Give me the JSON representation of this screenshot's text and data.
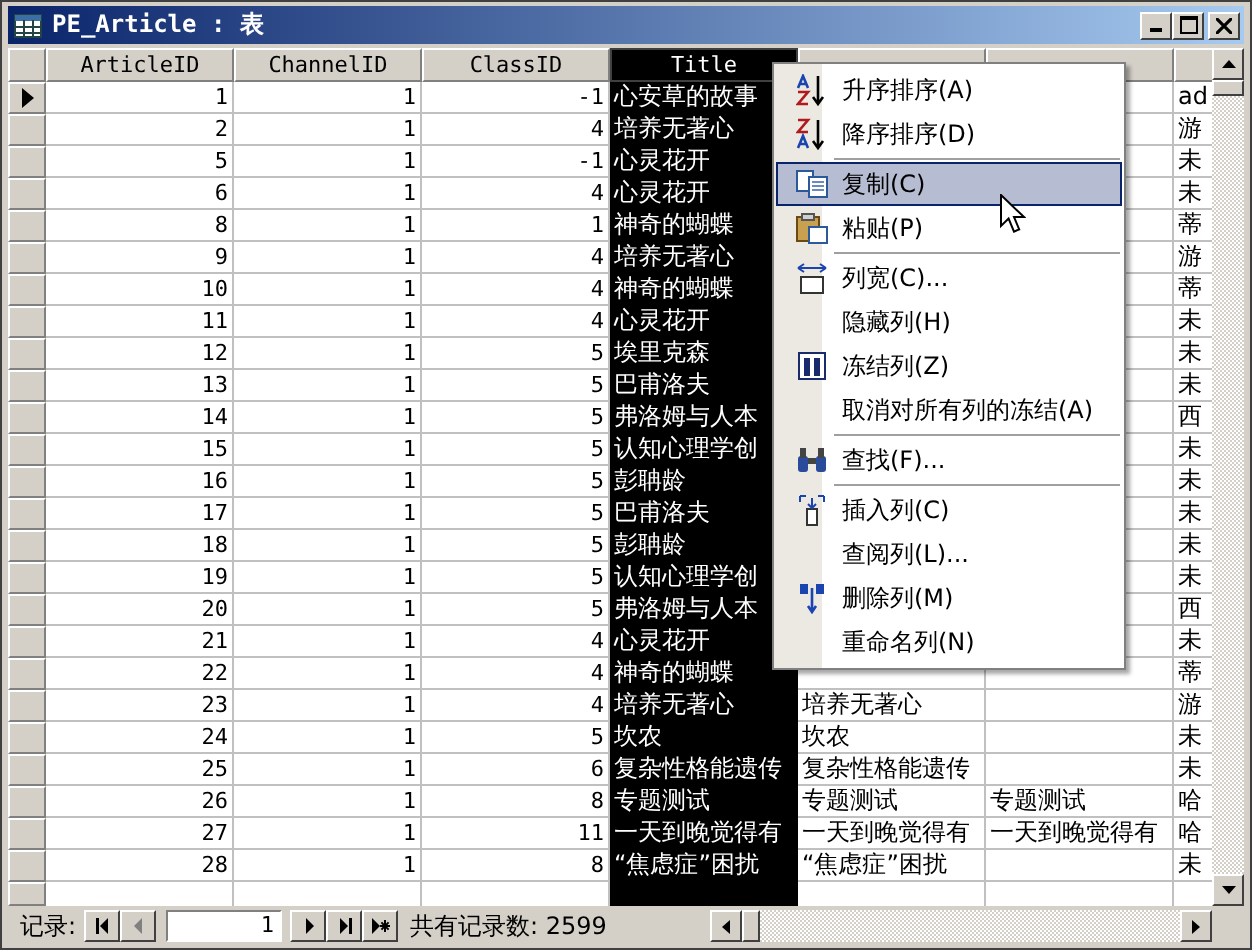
{
  "window": {
    "title": "PE_Article : 表"
  },
  "columns": [
    {
      "label": "ArticleID",
      "selected": false
    },
    {
      "label": "ChannelID",
      "selected": false
    },
    {
      "label": "ClassID",
      "selected": false
    },
    {
      "label": "Title",
      "selected": true
    },
    {
      "selected": false
    },
    {
      "selected": false
    },
    {
      "selected": false
    }
  ],
  "rows": [
    {
      "current": true,
      "cells": [
        "1",
        "1",
        "-1",
        "心安草的故事",
        "",
        "",
        "ad"
      ]
    },
    {
      "current": false,
      "cells": [
        "2",
        "1",
        "4",
        "培养无著心",
        "",
        "",
        "游"
      ]
    },
    {
      "current": false,
      "cells": [
        "5",
        "1",
        "-1",
        "心灵花开",
        "",
        "",
        "未"
      ]
    },
    {
      "current": false,
      "cells": [
        "6",
        "1",
        "4",
        "心灵花开",
        "",
        "",
        "未"
      ]
    },
    {
      "current": false,
      "cells": [
        "8",
        "1",
        "1",
        "神奇的蝴蝶",
        "",
        "",
        "蒂"
      ]
    },
    {
      "current": false,
      "cells": [
        "9",
        "1",
        "4",
        "培养无著心",
        "",
        "",
        "游"
      ]
    },
    {
      "current": false,
      "cells": [
        "10",
        "1",
        "4",
        "神奇的蝴蝶",
        "",
        "",
        "蒂"
      ]
    },
    {
      "current": false,
      "cells": [
        "11",
        "1",
        "4",
        "心灵花开",
        "",
        "",
        "未"
      ]
    },
    {
      "current": false,
      "cells": [
        "12",
        "1",
        "5",
        "埃里克森",
        "",
        "",
        "未"
      ]
    },
    {
      "current": false,
      "cells": [
        "13",
        "1",
        "5",
        "巴甫洛夫",
        "",
        "",
        "未"
      ]
    },
    {
      "current": false,
      "cells": [
        "14",
        "1",
        "5",
        "弗洛姆与人本",
        "",
        "",
        "西"
      ]
    },
    {
      "current": false,
      "cells": [
        "15",
        "1",
        "5",
        "认知心理学创",
        "",
        "",
        "未"
      ]
    },
    {
      "current": false,
      "cells": [
        "16",
        "1",
        "5",
        "彭聃龄",
        "",
        "",
        "未"
      ]
    },
    {
      "current": false,
      "cells": [
        "17",
        "1",
        "5",
        "巴甫洛夫",
        "",
        "",
        "未"
      ]
    },
    {
      "current": false,
      "cells": [
        "18",
        "1",
        "5",
        "彭聃龄",
        "",
        "",
        "未"
      ]
    },
    {
      "current": false,
      "cells": [
        "19",
        "1",
        "5",
        "认知心理学创",
        "",
        "",
        "未"
      ]
    },
    {
      "current": false,
      "cells": [
        "20",
        "1",
        "5",
        "弗洛姆与人本",
        "",
        "",
        "西"
      ]
    },
    {
      "current": false,
      "cells": [
        "21",
        "1",
        "4",
        "心灵花开",
        "",
        "",
        "未"
      ]
    },
    {
      "current": false,
      "cells": [
        "22",
        "1",
        "4",
        "神奇的蝴蝶",
        "",
        "",
        "蒂"
      ]
    },
    {
      "current": false,
      "cells": [
        "23",
        "1",
        "4",
        "培养无著心",
        "培养无著心",
        "",
        "游"
      ]
    },
    {
      "current": false,
      "cells": [
        "24",
        "1",
        "5",
        "坎农",
        "坎农",
        "",
        "未"
      ]
    },
    {
      "current": false,
      "cells": [
        "25",
        "1",
        "6",
        "复杂性格能遗传",
        "复杂性格能遗传",
        "",
        "未"
      ]
    },
    {
      "current": false,
      "cells": [
        "26",
        "1",
        "8",
        "专题测试",
        "专题测试",
        "专题测试",
        "哈"
      ]
    },
    {
      "current": false,
      "cells": [
        "27",
        "1",
        "11",
        "一天到晚觉得有",
        "一天到晚觉得有",
        "一天到晚觉得有",
        "哈"
      ]
    },
    {
      "current": false,
      "cells": [
        "28",
        "1",
        "8",
        "“焦虑症”困扰",
        "“焦虑症”困扰",
        "",
        "未"
      ]
    }
  ],
  "context_menu": [
    {
      "label": "升序排序(A)",
      "selected": false,
      "separator_after": false
    },
    {
      "label": "降序排序(D)",
      "selected": false,
      "separator_after": true
    },
    {
      "label": "复制(C)",
      "selected": true,
      "separator_after": false
    },
    {
      "label": "粘贴(P)",
      "selected": false,
      "separator_after": true
    },
    {
      "label": "列宽(C)...",
      "selected": false,
      "separator_after": false
    },
    {
      "label": "隐藏列(H)",
      "selected": false,
      "separator_after": false
    },
    {
      "label": "冻结列(Z)",
      "selected": false,
      "separator_after": false
    },
    {
      "label": "取消对所有列的冻结(A)",
      "selected": false,
      "separator_after": true
    },
    {
      "label": "查找(F)...",
      "selected": false,
      "separator_after": true
    },
    {
      "label": "插入列(C)",
      "selected": false,
      "separator_after": false
    },
    {
      "label": "查阅列(L)...",
      "selected": false,
      "separator_after": false
    },
    {
      "label": "删除列(M)",
      "selected": false,
      "separator_after": false
    },
    {
      "label": "重命名列(N)",
      "selected": false,
      "separator_after": false
    }
  ],
  "navigation": {
    "label": "记录:",
    "current_record": "1",
    "buttons": [
      {
        "disabled": false
      },
      {
        "disabled": true
      },
      {
        "disabled": false
      },
      {
        "disabled": false
      },
      {
        "disabled": false
      }
    ],
    "total": "共有记录数: 2599"
  }
}
